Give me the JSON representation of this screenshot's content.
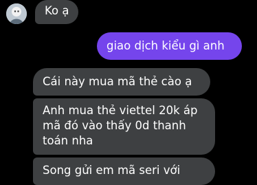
{
  "messages": [
    {
      "sender": "contact",
      "text": "Ko ạ"
    },
    {
      "sender": "me",
      "text": "giao dịch kiểu gì anh"
    },
    {
      "sender": "contact",
      "text": "Cái này mua mã thẻ cào ạ"
    },
    {
      "sender": "contact",
      "lines": [
        "Anh mua thẻ viettel 20k áp",
        "mã đó vào thấy 0d thanh",
        "toán nha"
      ]
    },
    {
      "sender": "contact",
      "text": "Song gửi em mã seri với"
    }
  ],
  "colors": {
    "background": "#000000",
    "incoming_bubble": "#3e4042",
    "outgoing_bubble": "#7545ec",
    "text": "#ffffff"
  },
  "icons": {
    "avatar": "contact-avatar-icon"
  }
}
